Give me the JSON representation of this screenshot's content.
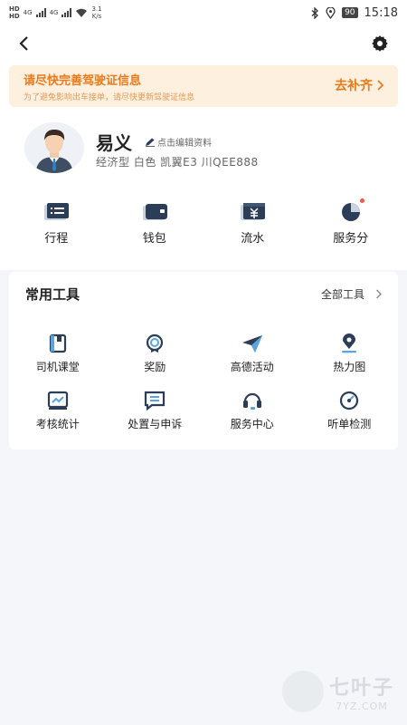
{
  "status_bar": {
    "net_speed_value": "3.1",
    "net_speed_unit": "K/s",
    "battery": "90",
    "time": "15:18",
    "sim_labels": [
      "HD",
      "HD"
    ],
    "network": [
      "4G",
      "4G"
    ]
  },
  "header": {
    "back_icon": "chevron-left-icon",
    "settings_icon": "gear-icon"
  },
  "notice": {
    "title": "请尽快完善驾驶证信息",
    "subtitle": "为了避免影响出车接单，请尽快更新驾驶证信息",
    "action": "去补齐"
  },
  "profile": {
    "name": "易义",
    "edit_label": "点击编辑资料",
    "car_info": "经济型 白色 凯翼E3  川QEE888"
  },
  "quick_actions": [
    {
      "label": "行程",
      "icon": "trip-icon"
    },
    {
      "label": "钱包",
      "icon": "wallet-icon"
    },
    {
      "label": "流水",
      "icon": "transactions-icon"
    },
    {
      "label": "服务分",
      "icon": "service-score-icon"
    }
  ],
  "tools": {
    "title": "常用工具",
    "all_label": "全部工具",
    "items": [
      {
        "label": "司机课堂",
        "icon": "book-icon"
      },
      {
        "label": "奖励",
        "icon": "reward-icon"
      },
      {
        "label": "高德活动",
        "icon": "paper-plane-icon"
      },
      {
        "label": "热力图",
        "icon": "location-pin-icon"
      },
      {
        "label": "考核统计",
        "icon": "stats-icon"
      },
      {
        "label": "处置与申诉",
        "icon": "message-icon"
      },
      {
        "label": "服务中心",
        "icon": "headset-icon"
      },
      {
        "label": "听单检测",
        "icon": "gauge-icon"
      }
    ]
  },
  "watermark": {
    "brand": "七叶子",
    "domain": "7YZ.COM"
  },
  "colors": {
    "accent_orange": "#e97a1d",
    "notice_bg": "#fdf0df",
    "icon_navy": "#2c3e57",
    "icon_light": "#c9d4e3",
    "badge_red": "#ef5a4c"
  }
}
